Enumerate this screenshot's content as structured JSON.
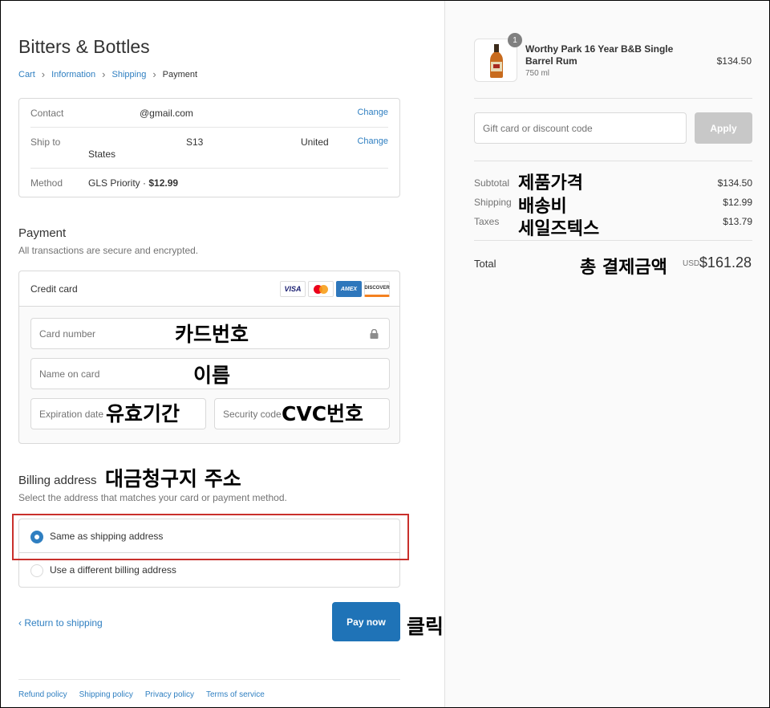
{
  "store": {
    "name": "Bitters & Bottles"
  },
  "breadcrumb": {
    "cart": "Cart",
    "information": "Information",
    "shipping": "Shipping",
    "payment": "Payment"
  },
  "review": {
    "contact_label": "Contact",
    "contact_value": "@gmail.com",
    "ship_label": "Ship to",
    "ship_value_1": "S13",
    "ship_value_2": "United",
    "ship_value_3": "States",
    "method_label": "Method",
    "method_value": "GLS Priority · ",
    "method_price": "$12.99",
    "change": "Change"
  },
  "payment": {
    "title": "Payment",
    "subtitle": "All transactions are secure and encrypted.",
    "method": "Credit card",
    "card_brands": [
      "VISA",
      "",
      "AMEX",
      "DISCOVER"
    ],
    "card_number_placeholder": "Card number",
    "name_placeholder": "Name on card",
    "expiry_placeholder": "Expiration date",
    "cvv_placeholder": "Security code"
  },
  "billing": {
    "title": "Billing address",
    "subtitle": "Select the address that matches your card or payment method.",
    "same": "Same as shipping address",
    "different": "Use a different billing address"
  },
  "actions": {
    "return": "‹ Return to shipping",
    "pay": "Pay now"
  },
  "footer": {
    "refund": "Refund policy",
    "shipping": "Shipping policy",
    "privacy": "Privacy policy",
    "terms": "Terms of service"
  },
  "annotations": {
    "card_number": "카드번호",
    "name": "이름",
    "expiry": "유효기간",
    "cvc": "CVC번호",
    "billing": "대금청구지 주소",
    "click": "클릭",
    "subtotal": "제품가격",
    "shipping": "배송비",
    "tax": "세일즈텍스",
    "total": "총 결제금액"
  },
  "order": {
    "product_name": "Worthy Park 16 Year B&B Single Barrel Rum",
    "product_variant": "750 ml",
    "product_price": "$134.50",
    "quantity": "1",
    "discount_placeholder": "Gift card or discount code",
    "apply": "Apply",
    "subtotal_label": "Subtotal",
    "subtotal_value": "$134.50",
    "shipping_label": "Shipping",
    "shipping_value": "$12.99",
    "taxes_label": "Taxes",
    "taxes_value": "$13.79",
    "total_label": "Total",
    "currency": "USD",
    "total_value": "$161.28"
  },
  "colors": {
    "accent": "#1f73b7",
    "link": "#2f7fc1",
    "highlight": "#c9302c"
  }
}
